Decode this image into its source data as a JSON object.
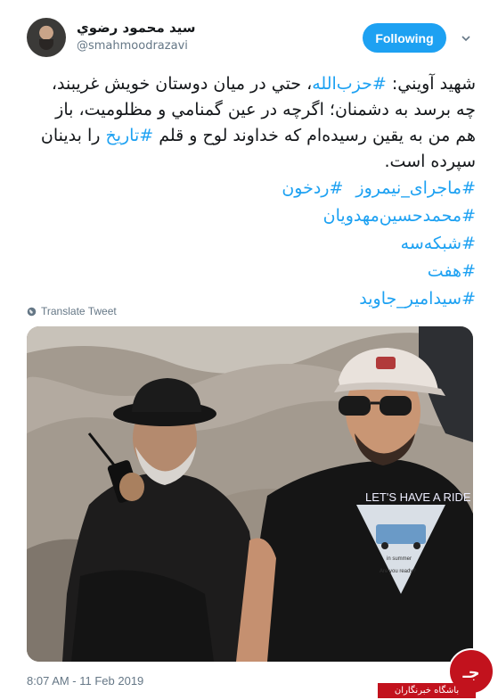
{
  "author": {
    "display_name": "سيد محمود رضوي",
    "handle": "@smahmoodrazavi"
  },
  "follow_button": {
    "label": "Following"
  },
  "menu_icon": "chevron-down-icon",
  "tweet": {
    "line1_prefix": "شهيد آويني: ",
    "line1_hashtag": "#حزب‌الله",
    "line1_suffix": "، حتي در ميان دوستان خويش غريبند،",
    "line2": "چه برسد به دشمنان؛ اگرچه در عين گمنامي و مظلوميت، باز",
    "line3_prefix": "هم من به يقين رسيده‌ام كه خداوند لوح و قلم ",
    "line3_hashtag": "#تاريخ",
    "line3_suffix": " را بدينان",
    "line4": "سپرده است."
  },
  "hashtags": {
    "row1_a": "#ماجرای_نیمروز",
    "row1_b": "#ردخون",
    "row2": "#محمدحسین‌مهدویان",
    "row3": "#شبکه‌سه",
    "row4": "#هفت",
    "row5": "#سیدامیر_جاوید"
  },
  "translate_label": "Translate Tweet",
  "photo": {
    "shirt_text": "LET'S HAVE A RIDE",
    "shirt_subtext": "in summer",
    "shirt_question": "Are you ready?",
    "cap_logo": "logo"
  },
  "timestamp": "8:07 AM - 11 Feb 2019",
  "watermark": {
    "label": "باشگاه خبرنگاران",
    "logo_glyph": "جـ"
  },
  "colors": {
    "accent": "#1da1f2",
    "text": "#14171a",
    "muted": "#657786",
    "watermark_red": "#c2121d"
  }
}
